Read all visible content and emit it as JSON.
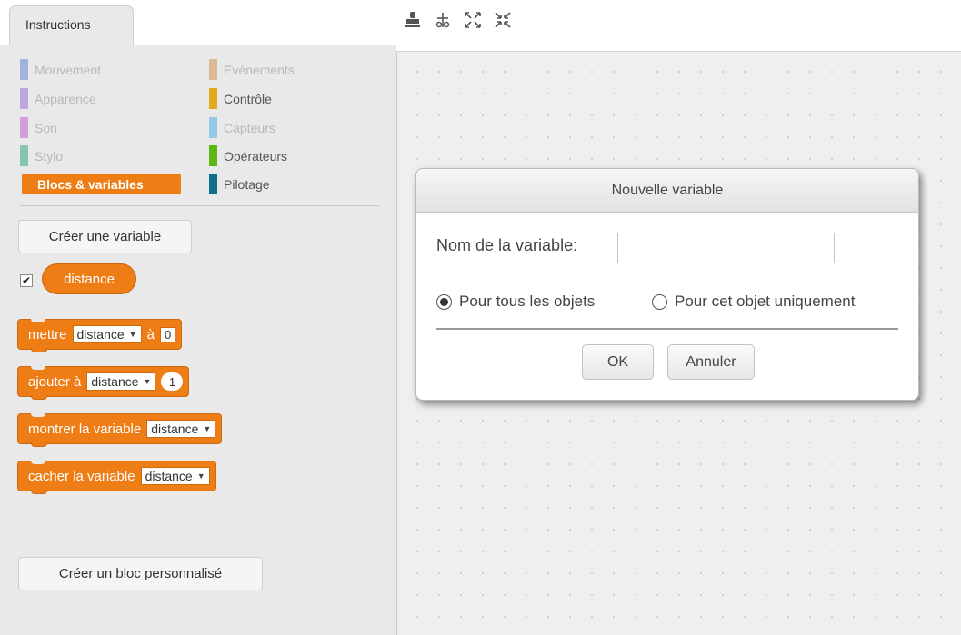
{
  "tabs": {
    "instructions_label": "Instructions"
  },
  "toolbar": {
    "icons": [
      "duplicate-stamp-icon",
      "cut-scissors-icon",
      "grow-icon",
      "shrink-icon"
    ]
  },
  "categories": {
    "left": [
      {
        "label": "Mouvement",
        "color": "#4a6cd4"
      },
      {
        "label": "Apparence",
        "color": "#8a55d7"
      },
      {
        "label": "Son",
        "color": "#bb42c3"
      },
      {
        "label": "Stylo",
        "color": "#0e9a6c"
      },
      {
        "label": "Blocs & variables",
        "color": "#ee7d16",
        "active": true
      }
    ],
    "right": [
      {
        "label": "Evénements",
        "color": "#c88330"
      },
      {
        "label": "Contrôle",
        "color": "#e1a91a"
      },
      {
        "label": "Capteurs",
        "color": "#2ca5e2"
      },
      {
        "label": "Opérateurs",
        "color": "#5cb712"
      },
      {
        "label": "Pilotage",
        "color": "#0e6f8a"
      }
    ]
  },
  "palette": {
    "create_variable_label": "Créer une variable",
    "variable_checked": true,
    "variable_name": "distance",
    "blocks": {
      "set": {
        "label_before": "mettre",
        "dropdown": "distance",
        "label_after": "à",
        "value": "0"
      },
      "change": {
        "label_before": "ajouter à",
        "dropdown": "distance",
        "value": "1"
      },
      "show": {
        "label_before": "montrer la variable",
        "dropdown": "distance"
      },
      "hide": {
        "label_before": "cacher la variable",
        "dropdown": "distance"
      }
    },
    "create_block_label": "Créer un bloc personnalisé"
  },
  "dialog": {
    "title": "Nouvelle variable",
    "name_label": "Nom de la variable:",
    "name_value": "",
    "radio_all_label": "Pour tous les objets",
    "radio_this_label": "Pour cet objet uniquement",
    "selected_scope": "all",
    "ok_label": "OK",
    "cancel_label": "Annuler"
  },
  "colors": {
    "variables_orange": "#ee7d16",
    "palette_bg": "#e9e9e9",
    "scripts_bg": "#efefef"
  }
}
